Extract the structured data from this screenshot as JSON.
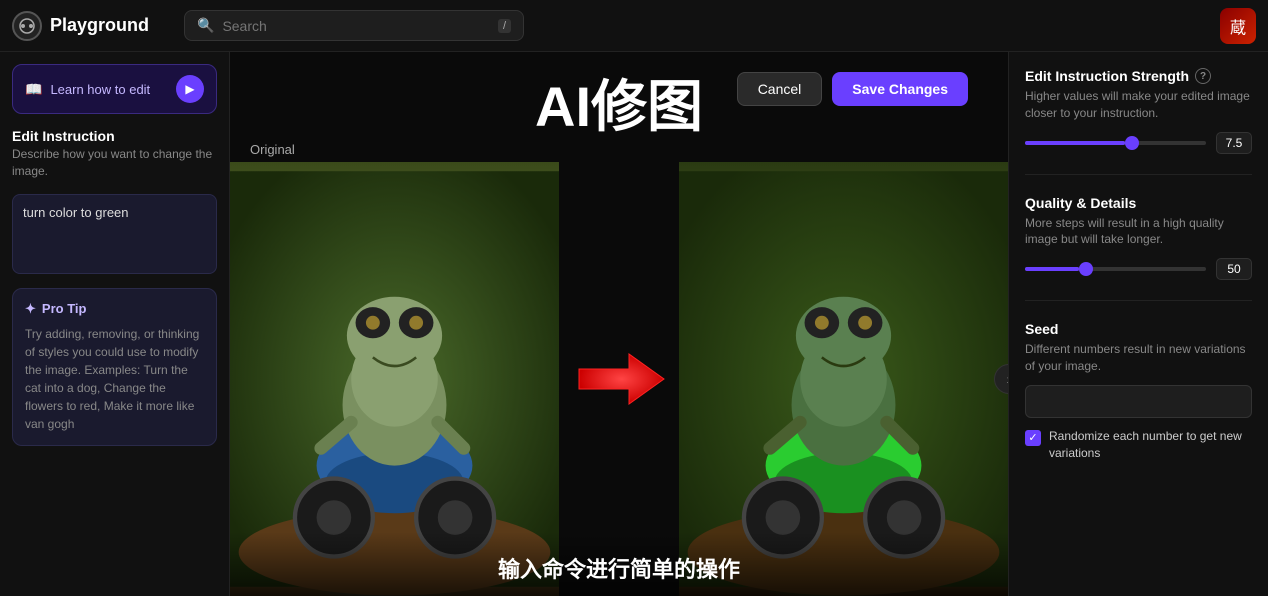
{
  "header": {
    "logo_icon": "⊙",
    "logo_text": "Playground",
    "search_placeholder": "Search",
    "search_shortcut": "/",
    "user_avatar": "蔵"
  },
  "sidebar": {
    "learn_btn_label": "Learn how to edit",
    "learn_btn_icon": "▶",
    "edit_instruction_title": "Edit Instruction",
    "edit_instruction_desc": "Describe how you want to change the image.",
    "edit_instruction_value": "turn color to green",
    "pro_tip_title": "Pro Tip",
    "pro_tip_icon": "✦",
    "pro_tip_text": "Try adding, removing, or thinking of styles you could use to modify the image. Examples: Turn the cat into a dog, Change the flowers to red, Make it more like van gogh"
  },
  "toolbar": {
    "cancel_label": "Cancel",
    "save_label": "Save Changes"
  },
  "center": {
    "big_title": "AI修图",
    "original_label": "Original",
    "bottom_text": "输入命令进行简单的操作"
  },
  "right_panel": {
    "strength_title": "Edit Instruction Strength",
    "strength_desc": "Higher values will make your edited image closer to your instruction.",
    "strength_value": "7.5",
    "strength_pct": 55,
    "quality_title": "Quality & Details",
    "quality_desc": "More steps will result in a high quality image but will take longer.",
    "quality_value": "50",
    "quality_pct": 30,
    "seed_title": "Seed",
    "seed_desc": "Different numbers result in new variations of your image.",
    "seed_placeholder": "",
    "randomize_label": "Randomize each number to get new variations"
  }
}
